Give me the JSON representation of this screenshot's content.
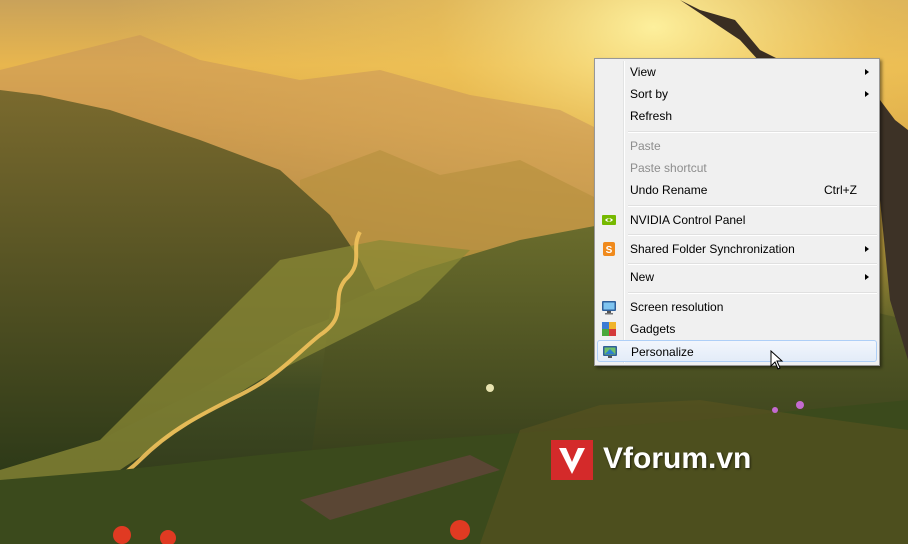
{
  "menu": {
    "items": [
      {
        "label": "View",
        "shortcut": "",
        "submenu": true,
        "disabled": false,
        "icon": ""
      },
      {
        "label": "Sort by",
        "shortcut": "",
        "submenu": true,
        "disabled": false,
        "icon": ""
      },
      {
        "label": "Refresh",
        "shortcut": "",
        "submenu": false,
        "disabled": false,
        "icon": ""
      },
      {
        "label": "Paste",
        "shortcut": "",
        "submenu": false,
        "disabled": true,
        "icon": ""
      },
      {
        "label": "Paste shortcut",
        "shortcut": "",
        "submenu": false,
        "disabled": true,
        "icon": ""
      },
      {
        "label": "Undo Rename",
        "shortcut": "Ctrl+Z",
        "submenu": false,
        "disabled": false,
        "icon": ""
      },
      {
        "label": "NVIDIA Control Panel",
        "shortcut": "",
        "submenu": false,
        "disabled": false,
        "icon": "nvidia-icon"
      },
      {
        "label": "Shared Folder Synchronization",
        "shortcut": "",
        "submenu": true,
        "disabled": false,
        "icon": "sync-icon"
      },
      {
        "label": "New",
        "shortcut": "",
        "submenu": true,
        "disabled": false,
        "icon": ""
      },
      {
        "label": "Screen resolution",
        "shortcut": "",
        "submenu": false,
        "disabled": false,
        "icon": "monitor-icon"
      },
      {
        "label": "Gadgets",
        "shortcut": "",
        "submenu": false,
        "disabled": false,
        "icon": "gadgets-icon"
      },
      {
        "label": "Personalize",
        "shortcut": "",
        "submenu": false,
        "disabled": false,
        "icon": "personalize-icon",
        "highlighted": true
      }
    ]
  },
  "watermark": {
    "text": "Vforum.vn",
    "logo_letter": "V"
  },
  "colors": {
    "highlight_border": "#aecff7",
    "disabled_text": "#8d8d8d",
    "watermark_red": "#d42a2a"
  }
}
